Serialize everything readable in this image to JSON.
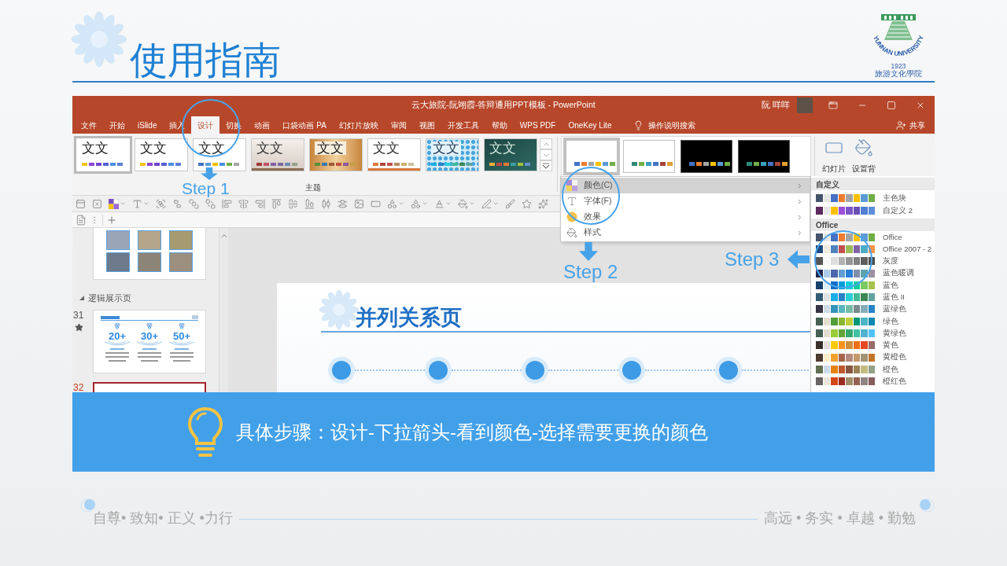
{
  "header": {
    "title": "使用指南",
    "logo": {
      "ring": "YUNNAN UNIVERSITY",
      "year": "1923",
      "school": "旅游文化學院"
    }
  },
  "window": {
    "title": "云大旅院-阮翊霞-答辩通用PPT模板 - PowerPoint",
    "user": "阮 咩咩",
    "tell_me": "操作说明搜索",
    "share": "共享"
  },
  "tabs": [
    {
      "label": "文件",
      "selected": false
    },
    {
      "label": "开始",
      "selected": false
    },
    {
      "label": "iSlide",
      "selected": false
    },
    {
      "label": "插入",
      "selected": false
    },
    {
      "label": "设计",
      "selected": true
    },
    {
      "label": "切换",
      "selected": false
    },
    {
      "label": "动画",
      "selected": false
    },
    {
      "label": "口袋动画 PA",
      "selected": false
    },
    {
      "label": "幻灯片放映",
      "selected": false
    },
    {
      "label": "审阅",
      "selected": false
    },
    {
      "label": "视图",
      "selected": false
    },
    {
      "label": "开发工具",
      "selected": false
    },
    {
      "label": "帮助",
      "selected": false
    },
    {
      "label": "WPS PDF",
      "selected": false
    },
    {
      "label": "OneKey Lite",
      "selected": false
    }
  ],
  "themes": {
    "label": "主题",
    "items": [
      {
        "sample": "文文",
        "kind": "white",
        "selected": true,
        "swatches": [
          {
            "color": "#f2c314"
          },
          {
            "color": "#8e44d6"
          },
          {
            "color": "#7446d0"
          },
          {
            "color": "#5a5fd6"
          },
          {
            "color": "#4a8fe2"
          },
          {
            "color": "#5b7fd8"
          }
        ]
      },
      {
        "sample": "文文",
        "kind": "white",
        "selected": false,
        "swatches": [
          {
            "color": "#f2c314"
          },
          {
            "color": "#8e44d6"
          },
          {
            "color": "#7446d0"
          },
          {
            "color": "#5a5fd6"
          },
          {
            "color": "#4a8fe2"
          },
          {
            "color": "#5b7fd8"
          }
        ]
      },
      {
        "sample": "文文",
        "kind": "white",
        "selected": false,
        "swatches": [
          {
            "color": "#4472c4"
          },
          {
            "color": "#5b9bd5"
          },
          {
            "color": "#ffc000"
          },
          {
            "color": "#4a8fe2"
          },
          {
            "color": "#70ad47"
          },
          {
            "color": "#a5a5a5"
          }
        ]
      },
      {
        "sample": "文文",
        "kind": "beige",
        "selected": false,
        "swatches": [
          {
            "color": "#a03a3a"
          },
          {
            "color": "#c05068"
          },
          {
            "color": "#8064a2"
          },
          {
            "color": "#7b6a9a"
          },
          {
            "color": "#6a8ab0"
          },
          {
            "color": "#94a088"
          }
        ]
      },
      {
        "sample": "文文",
        "kind": "wood",
        "selected": false,
        "swatches": [
          {
            "color": "#5a8f3a"
          },
          {
            "color": "#3a7aa8"
          },
          {
            "color": "#9b5a3a"
          },
          {
            "color": "#c05040"
          },
          {
            "color": "#8a5a9a"
          },
          {
            "color": "#c0a040"
          }
        ]
      },
      {
        "sample": "文文",
        "kind": "lined",
        "selected": false,
        "swatches": [
          {
            "color": "#e07b39"
          },
          {
            "color": "#a94a3a"
          },
          {
            "color": "#c0504d"
          },
          {
            "color": "#b58b60"
          },
          {
            "color": "#d0b070"
          },
          {
            "color": "#c8c0a0"
          }
        ]
      },
      {
        "sample": "文文",
        "kind": "pattern",
        "selected": false,
        "swatches": [
          {
            "color": "#1cade4"
          },
          {
            "color": "#2683c6"
          },
          {
            "color": "#27ced7"
          },
          {
            "color": "#42ba97"
          },
          {
            "color": "#3e8853"
          },
          {
            "color": "#62a39f"
          }
        ]
      },
      {
        "sample": "文文",
        "kind": "chalkboard",
        "selected": false,
        "swatches": [
          {
            "color": "#e8b038"
          },
          {
            "color": "#c04848"
          },
          {
            "color": "#e07838"
          },
          {
            "color": "#3aa0a0"
          },
          {
            "color": "#a0c040"
          },
          {
            "color": "#6a8fd0"
          }
        ]
      }
    ]
  },
  "variants": [
    {
      "kind": "light",
      "selected": true,
      "swatches": [
        {
          "color": "#4472c4"
        },
        {
          "color": "#ed7d31"
        },
        {
          "color": "#a5a5a5"
        },
        {
          "color": "#ffc000"
        },
        {
          "color": "#5b9bd5"
        },
        {
          "color": "#70ad47"
        }
      ]
    },
    {
      "kind": "light",
      "selected": false,
      "swatches": [
        {
          "color": "#2e8b7a"
        },
        {
          "color": "#70ad47"
        },
        {
          "color": "#3aa0c0"
        },
        {
          "color": "#4472c4"
        },
        {
          "color": "#a5443a"
        },
        {
          "color": "#e0a030"
        }
      ]
    },
    {
      "kind": "dark",
      "selected": false,
      "swatches": [
        {
          "color": "#4472c4"
        },
        {
          "color": "#ed7d31"
        },
        {
          "color": "#a5a5a5"
        },
        {
          "color": "#ffc000"
        },
        {
          "color": "#5b9bd5"
        },
        {
          "color": "#70ad47"
        }
      ]
    },
    {
      "kind": "dark",
      "selected": false,
      "swatches": [
        {
          "color": "#2e8b7a"
        },
        {
          "color": "#70ad47"
        },
        {
          "color": "#3aa0c0"
        },
        {
          "color": "#4472c4"
        },
        {
          "color": "#a5443a"
        },
        {
          "color": "#e0a030"
        }
      ]
    }
  ],
  "customize": [
    {
      "label": "幻灯片",
      "kind": "slide-size"
    },
    {
      "label": "设置背",
      "kind": "background"
    }
  ],
  "slide_panel": {
    "sections": [
      {
        "slides": [
          {
            "kind": "photos",
            "selected": false
          }
        ]
      },
      {
        "title": "逻辑展示页",
        "expanded": true,
        "slides": [
          {
            "number": "31",
            "kind": "stats",
            "starred": true,
            "selected": false,
            "stats": [
              "20+",
              "30+",
              "50+"
            ]
          },
          {
            "number": "32",
            "kind": "blank",
            "selected": true
          }
        ]
      }
    ]
  },
  "slide": {
    "title": "并列关系页"
  },
  "menu": [
    {
      "label": "颜色(C)",
      "kind": "colors",
      "selected": true
    },
    {
      "label": "字体(F)",
      "kind": "fonts",
      "selected": false
    },
    {
      "label": "效果",
      "kind": "effects",
      "selected": false
    },
    {
      "label": "样式",
      "kind": "background",
      "selected": false
    }
  ],
  "submenu": [
    {
      "title": "自定义",
      "rows": [
        {
          "label": "主色块",
          "swatches": [
            {
              "color": "#44546a"
            },
            {
              "color": "#e7e6e6"
            },
            {
              "color": "#4472c4"
            },
            {
              "color": "#ed7d31"
            },
            {
              "color": "#a5a5a5"
            },
            {
              "color": "#ffc000"
            },
            {
              "color": "#5b9bd5"
            },
            {
              "color": "#70ad47"
            }
          ]
        },
        {
          "label": "自定义 2",
          "swatches": [
            {
              "color": "#5b2a5e"
            },
            {
              "color": "#e7e6e6"
            },
            {
              "color": "#ffc000"
            },
            {
              "color": "#9c4fd6"
            },
            {
              "color": "#7d56c6"
            },
            {
              "color": "#6a4fb4"
            },
            {
              "color": "#4e7fd0"
            },
            {
              "color": "#5b8ed8"
            }
          ]
        }
      ]
    },
    {
      "title": "Office",
      "rows": [
        {
          "label": "Office",
          "swatches": [
            {
              "color": "#44546a"
            },
            {
              "color": "#e7e6e6"
            },
            {
              "color": "#4472c4"
            },
            {
              "color": "#ed7d31"
            },
            {
              "color": "#a5a5a5"
            },
            {
              "color": "#ffc000"
            },
            {
              "color": "#5b9bd5"
            },
            {
              "color": "#70ad47"
            }
          ]
        },
        {
          "label": "Office 2007 - 2",
          "swatches": [
            {
              "color": "#1f497d"
            },
            {
              "color": "#eeece1"
            },
            {
              "color": "#4f81bd"
            },
            {
              "color": "#c0504d"
            },
            {
              "color": "#9bbb59"
            },
            {
              "color": "#8064a2"
            },
            {
              "color": "#4bacc6"
            },
            {
              "color": "#f79646"
            }
          ]
        },
        {
          "label": "灰度",
          "swatches": [
            {
              "color": "#555555"
            },
            {
              "color": "#f8f8f8"
            },
            {
              "color": "#dddddd"
            },
            {
              "color": "#b2b2b2"
            },
            {
              "color": "#969696"
            },
            {
              "color": "#808080"
            },
            {
              "color": "#5f5f5f"
            },
            {
              "color": "#4d4d4d"
            }
          ]
        },
        {
          "label": "蓝色暖调",
          "swatches": [
            {
              "color": "#242852"
            },
            {
              "color": "#acccea"
            },
            {
              "color": "#4a66ac"
            },
            {
              "color": "#629dd1"
            },
            {
              "color": "#297fd5"
            },
            {
              "color": "#7f8fa9"
            },
            {
              "color": "#5aa2ae"
            },
            {
              "color": "#9d90a0"
            }
          ]
        },
        {
          "label": "蓝色",
          "swatches": [
            {
              "color": "#17406d"
            },
            {
              "color": "#dbeff9"
            },
            {
              "color": "#0f6fc6"
            },
            {
              "color": "#009dd9"
            },
            {
              "color": "#0bd0d9"
            },
            {
              "color": "#10cf9b"
            },
            {
              "color": "#7cca62"
            },
            {
              "color": "#a5c249"
            }
          ]
        },
        {
          "label": "蓝色 II",
          "swatches": [
            {
              "color": "#335b74"
            },
            {
              "color": "#dfe3e5"
            },
            {
              "color": "#1cade4"
            },
            {
              "color": "#2683c6"
            },
            {
              "color": "#27ced7"
            },
            {
              "color": "#42ba97"
            },
            {
              "color": "#3e8853"
            },
            {
              "color": "#62a39f"
            }
          ]
        },
        {
          "label": "蓝绿色",
          "swatches": [
            {
              "color": "#373545"
            },
            {
              "color": "#cedbe6"
            },
            {
              "color": "#3494ba"
            },
            {
              "color": "#58b6c0"
            },
            {
              "color": "#75bda7"
            },
            {
              "color": "#7a8c8e"
            },
            {
              "color": "#84acb6"
            },
            {
              "color": "#2683c6"
            }
          ]
        },
        {
          "label": "绿色",
          "swatches": [
            {
              "color": "#455f51"
            },
            {
              "color": "#e3ded1"
            },
            {
              "color": "#549e39"
            },
            {
              "color": "#8ab833"
            },
            {
              "color": "#c0cf3a"
            },
            {
              "color": "#029676"
            },
            {
              "color": "#4ab5c4"
            },
            {
              "color": "#0989b1"
            }
          ]
        },
        {
          "label": "黄绿色",
          "swatches": [
            {
              "color": "#455f51"
            },
            {
              "color": "#e3ded1"
            },
            {
              "color": "#99cb38"
            },
            {
              "color": "#63a537"
            },
            {
              "color": "#37a76f"
            },
            {
              "color": "#44c1a3"
            },
            {
              "color": "#4eb3cf"
            },
            {
              "color": "#51c3f9"
            }
          ]
        },
        {
          "label": "黄色",
          "swatches": [
            {
              "color": "#39302a"
            },
            {
              "color": "#e5dedb"
            },
            {
              "color": "#ffca08"
            },
            {
              "color": "#f8931d"
            },
            {
              "color": "#ce8d3e"
            },
            {
              "color": "#ec7016"
            },
            {
              "color": "#e64823"
            },
            {
              "color": "#9c6a6a"
            }
          ]
        },
        {
          "label": "黄橙色",
          "swatches": [
            {
              "color": "#4e3b30"
            },
            {
              "color": "#fbeec9"
            },
            {
              "color": "#f0a22e"
            },
            {
              "color": "#a5644e"
            },
            {
              "color": "#b58b80"
            },
            {
              "color": "#c3986d"
            },
            {
              "color": "#a19574"
            },
            {
              "color": "#c17529"
            }
          ]
        },
        {
          "label": "橙色",
          "swatches": [
            {
              "color": "#637052"
            },
            {
              "color": "#ccddea"
            },
            {
              "color": "#e48312"
            },
            {
              "color": "#bd582c"
            },
            {
              "color": "#865640"
            },
            {
              "color": "#9b8357"
            },
            {
              "color": "#c2bc80"
            },
            {
              "color": "#94a088"
            }
          ]
        },
        {
          "label": "橙红色",
          "swatches": [
            {
              "color": "#696464"
            },
            {
              "color": "#e9e5dc"
            },
            {
              "color": "#d34817"
            },
            {
              "color": "#9b2d1f"
            },
            {
              "color": "#a28e6a"
            },
            {
              "color": "#956251"
            },
            {
              "color": "#918485"
            },
            {
              "color": "#855d5d"
            }
          ]
        }
      ]
    }
  ],
  "steps": [
    {
      "label": "Step 1",
      "kind": "down"
    },
    {
      "label": "Step 2",
      "kind": "down"
    },
    {
      "label": "Step 3",
      "kind": "left"
    }
  ],
  "banner": {
    "text": "具体步骤：设计-下拉箭头-看到颜色-选择需要更换的颜色"
  },
  "footer": {
    "left": "自尊• 致知• 正义 •力行",
    "right": "高远 • 务实 • 卓越 • 勤勉"
  }
}
